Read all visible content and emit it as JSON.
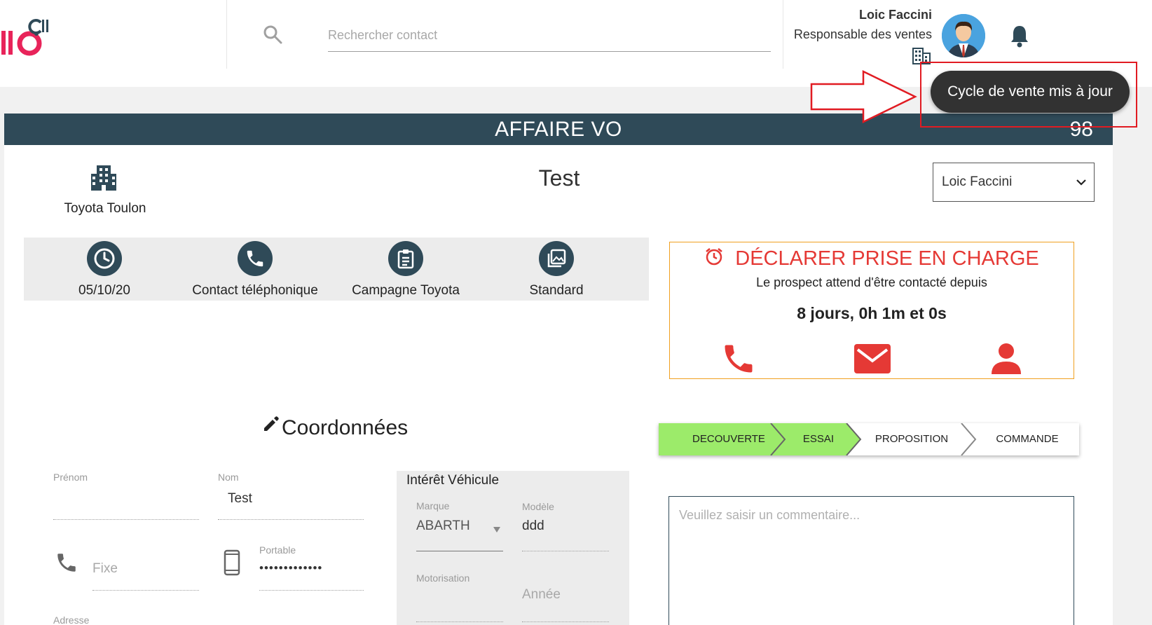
{
  "header": {
    "search_placeholder": "Rechercher contact",
    "user_name": "Loic Faccini",
    "user_role": "Responsable des ventes"
  },
  "toast": {
    "message": "Cycle de vente mis à jour"
  },
  "deal": {
    "type_title": "AFFAIRE VO",
    "count": "98",
    "site": "Toyota Toulon",
    "name": "Test",
    "owner": "Loic Faccini"
  },
  "info": {
    "date": "05/10/20",
    "channel": "Contact téléphonique",
    "campaign": "Campagne Toyota",
    "source": "Standard"
  },
  "alert": {
    "title": "DÉCLARER PRISE EN CHARGE",
    "subtitle": "Le prospect attend d'être contacté depuis",
    "delay": "8 jours, 0h 1m et 0s"
  },
  "pipeline": {
    "stages": [
      {
        "label": "DECOUVERTE",
        "done": true
      },
      {
        "label": "ESSAI",
        "done": true
      },
      {
        "label": "PROPOSITION",
        "done": false
      },
      {
        "label": "COMMANDE",
        "done": false
      }
    ]
  },
  "contact": {
    "section_title": "Coordonnées",
    "firstname_label": "Prénom",
    "firstname_value": "",
    "lastname_label": "Nom",
    "lastname_value": "Test",
    "phone_placeholder": "Fixe",
    "mobile_label": "Portable",
    "mobile_value": "•••••••••••••",
    "address_label": "Adresse"
  },
  "vehicle": {
    "title": "Intérêt Véhicule",
    "brand_label": "Marque",
    "brand_value": "ABARTH",
    "model_label": "Modèle",
    "model_value": "ddd",
    "engine_label": "Motorisation",
    "year_placeholder": "Année"
  },
  "comment": {
    "placeholder": "Veuillez saisir un commentaire..."
  },
  "colors": {
    "primary": "#2f4a58",
    "alert_red": "#e53935",
    "stage_done": "#9ceb6a",
    "annotation_red": "#e11b22",
    "logo_pink": "#e8245a"
  }
}
